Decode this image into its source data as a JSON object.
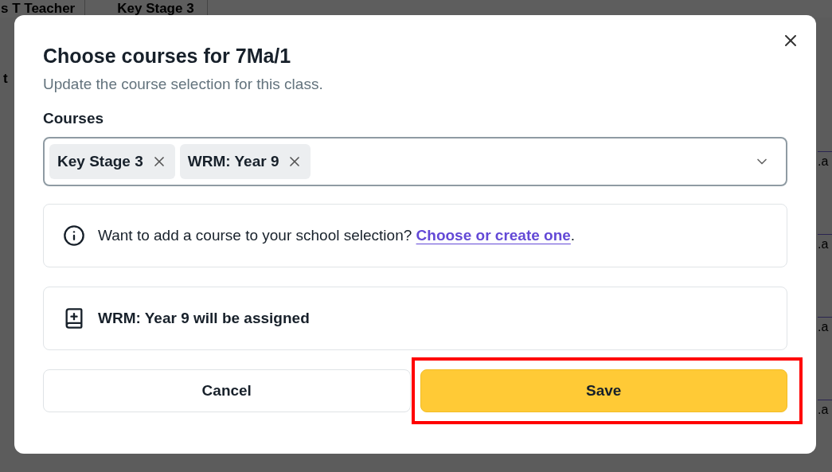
{
  "background": {
    "header_cells": [
      "s T Teacher",
      "Key Stage 3"
    ],
    "left_fragment": "t",
    "right_fragments": [
      ".a",
      ".a",
      ".a",
      ".a"
    ]
  },
  "dialog": {
    "title": "Choose courses for 7Ma/1",
    "subtitle": "Update the course selection for this class.",
    "courses_label": "Courses",
    "selected_courses": [
      {
        "label": "Key Stage 3"
      },
      {
        "label": "WRM: Year 9"
      }
    ],
    "info": {
      "text": "Want to add a course to your school selection? ",
      "link": "Choose or create one",
      "suffix": "."
    },
    "assignment_notice": "WRM: Year 9 will be assigned",
    "buttons": [
      {
        "label": "Cancel",
        "kind": "secondary",
        "highlighted": false
      },
      {
        "label": "Save",
        "kind": "primary",
        "highlighted": true
      }
    ]
  }
}
